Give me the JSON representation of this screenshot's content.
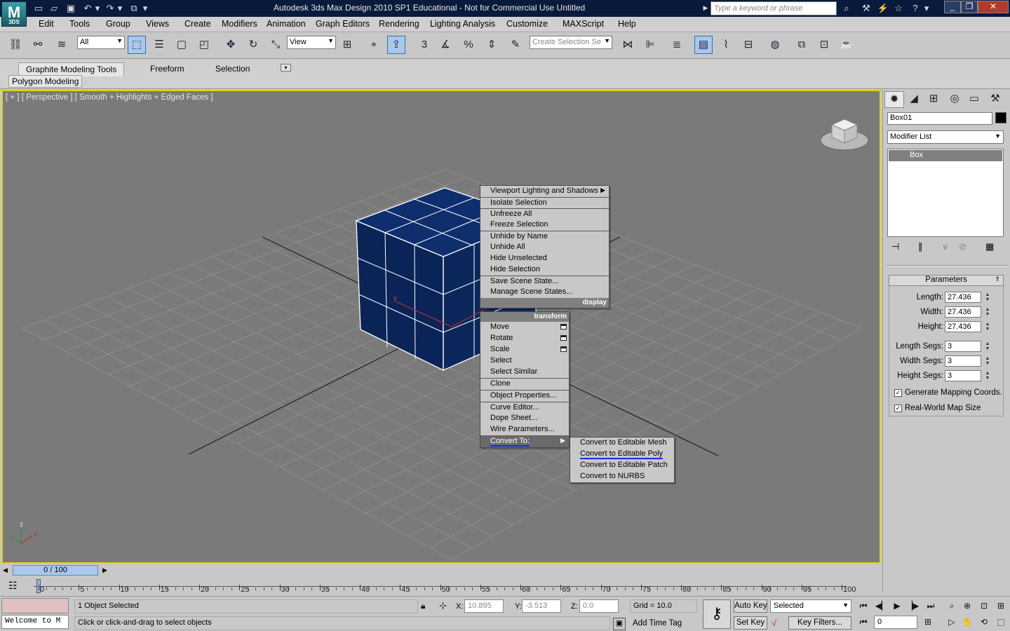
{
  "title_bar": {
    "title": "Autodesk 3ds Max Design 2010 SP1   Educational - Not for Commercial Use     Untitled",
    "search_placeholder": "Type a keyword or phrase",
    "logo_text": "M",
    "logo_sub": "3DS"
  },
  "menu": [
    "Edit",
    "Tools",
    "Group",
    "Views",
    "Create",
    "Modifiers",
    "Animation",
    "Graph Editors",
    "Rendering",
    "Lighting Analysis",
    "Customize",
    "MAXScript",
    "Help"
  ],
  "toolbar": {
    "selection_filter": "All",
    "ref_coord": "View",
    "named_selection_placeholder": "Create Selection Se",
    "snaps": "3"
  },
  "ribbon": {
    "tabs": [
      "Graphite Modeling Tools",
      "Freeform",
      "Selection"
    ],
    "panel": "Polygon Modeling"
  },
  "viewport": {
    "label": "[ + ] [ Perspective ] [ Smooth + Highlights + Edged Faces ]",
    "axis_y": "y",
    "axis_z": "z",
    "axis_x": "x"
  },
  "context_menu": {
    "display_items": [
      "Viewport Lighting and Shadows",
      "Isolate Selection",
      "Unfreeze All",
      "Freeze Selection",
      "Unhide by Name",
      "Unhide All",
      "Hide Unselected",
      "Hide Selection",
      "Save Scene State...",
      "Manage Scene States..."
    ],
    "display_header": "display",
    "transform_header": "transform",
    "transform_items": [
      "Move",
      "Rotate",
      "Scale",
      "Select",
      "Select Similar",
      "Clone",
      "Object Properties...",
      "Curve Editor...",
      "Dope Sheet...",
      "Wire Parameters...",
      "Convert To:"
    ],
    "convert_items": [
      "Convert to Editable Mesh",
      "Convert to Editable Poly",
      "Convert to Editable Patch",
      "Convert to NURBS"
    ]
  },
  "command_panel": {
    "object_name": "Box01",
    "modifier_list": "Modifier List",
    "stack_item": "Box",
    "rollout_title": "Parameters",
    "params": [
      {
        "label": "Length:",
        "value": "27.436"
      },
      {
        "label": "Width:",
        "value": "27.436"
      },
      {
        "label": "Height:",
        "value": "27.436"
      },
      {
        "label": "Length Segs:",
        "value": "3"
      },
      {
        "label": "Width Segs:",
        "value": "3"
      },
      {
        "label": "Height Segs:",
        "value": "3"
      }
    ],
    "checkboxes": [
      {
        "label": "Generate Mapping Coords.",
        "checked": true
      },
      {
        "label": "Real-World Map Size",
        "checked": true
      }
    ]
  },
  "timeline": {
    "slider": "0 / 100",
    "ticks": [
      "0",
      "5",
      "10",
      "15",
      "20",
      "25",
      "30",
      "35",
      "40",
      "45",
      "50",
      "55",
      "60",
      "65",
      "70",
      "75",
      "80",
      "85",
      "90",
      "95",
      "100"
    ]
  },
  "status": {
    "maxscript": "Welcome to M",
    "selected": "1 Object Selected",
    "prompt": "Click or click-and-drag to select objects",
    "x_label": "X:",
    "x": "10.895",
    "y_label": "Y:",
    "y": "-3.513",
    "z_label": "Z:",
    "z": "0.0",
    "grid": "Grid = 10.0",
    "add_time_tag": "Add Time Tag",
    "auto_key": "Auto Key",
    "set_key": "Set Key",
    "key_mode": "Selected",
    "key_filters": "Key Filters...",
    "frame": "0"
  },
  "colors": {
    "viewport_border": "#e8d218",
    "box_face": "#0a2458",
    "grid_line": "#8c8c8c",
    "title_bg": "#0a1a3c"
  }
}
